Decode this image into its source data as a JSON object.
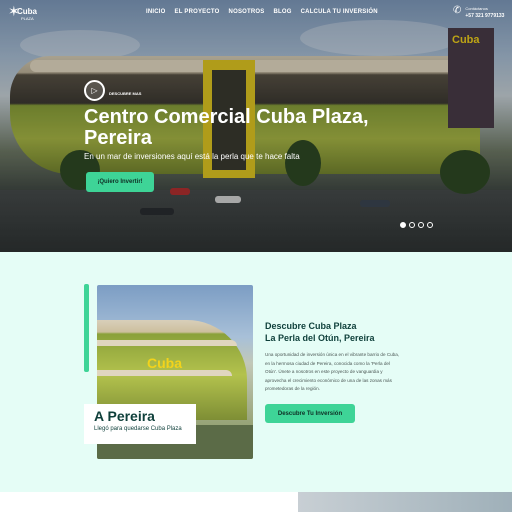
{
  "header": {
    "logo": {
      "name": "Cuba",
      "sub": "PLAZA"
    },
    "nav": [
      "INICIO",
      "EL PROYECTO",
      "NOSOTROS",
      "BLOG",
      "CALCULA TU INVERSIÓN"
    ],
    "contact": {
      "label": "Contáctanos",
      "phone": "+57 321 9779133"
    }
  },
  "hero": {
    "video_label": "DESCUBRE MAS",
    "title": "Centro Comercial Cuba Plaza, Pereira",
    "subtitle": "En un mar de inversiones aquí está la perla que te hace falta",
    "cta": "¡Quiero Invertir!",
    "sign_text": "Cuba",
    "slides": 4,
    "active_slide": 1
  },
  "discover": {
    "photo_brand": "Cuba",
    "caption_title": "A Pereira",
    "caption_sub": "Llegó para quedarse Cuba Plaza",
    "title_line1": "Descubre Cuba Plaza",
    "title_line2": "La Perla del Otún, Pereira",
    "body": "Una oportunidad de inversión única en el vibrante barrio de Cuba, en la hermosa ciudad de Pereira, conocida como la 'Perla del Otún'. Únete a nosotros en este proyecto de vanguardia y aprovecha el crecimiento económico de una de las zonas más prometedoras de la región.",
    "cta": "Descubre Tu Inversión"
  },
  "colors": {
    "accent": "#3ed497",
    "section_bg": "#e5fdf6",
    "heading": "#0e3f3a",
    "brand_yellow": "#f2d31b"
  }
}
